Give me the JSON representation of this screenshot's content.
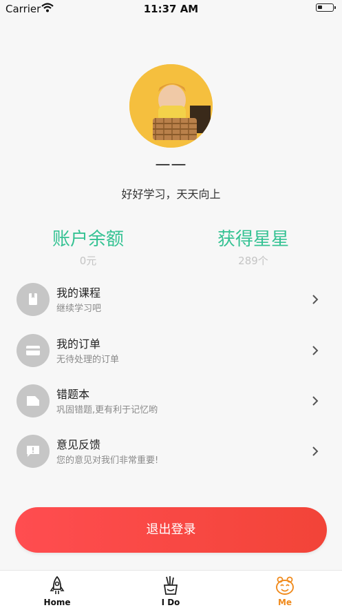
{
  "status_bar": {
    "carrier": "Carrier",
    "time": "11:37 AM"
  },
  "profile": {
    "name": "——",
    "motto": "好好学习，天天向上"
  },
  "stats": [
    {
      "title": "账户余额",
      "value": "0元"
    },
    {
      "title": "获得星星",
      "value": "289个"
    }
  ],
  "menu": [
    {
      "title": "我的课程",
      "subtitle": "继续学习吧",
      "icon": "book-icon"
    },
    {
      "title": "我的订单",
      "subtitle": "无待处理的订单",
      "icon": "card-icon"
    },
    {
      "title": "错题本",
      "subtitle": "巩固错题,更有利于记忆哟",
      "icon": "note-icon"
    },
    {
      "title": "意见反馈",
      "subtitle": "您的意见对我们非常重要!",
      "icon": "feedback-icon"
    }
  ],
  "logout_label": "退出登录",
  "tabs": [
    {
      "label": "Home",
      "icon": "rocket-icon",
      "active": false
    },
    {
      "label": "I Do",
      "icon": "pencil-cup-icon",
      "active": false
    },
    {
      "label": "Me",
      "icon": "mascot-icon",
      "active": true
    }
  ],
  "colors": {
    "accent_green": "#35c293",
    "logout_red": "#f24438",
    "tab_active": "#f08a1c"
  }
}
